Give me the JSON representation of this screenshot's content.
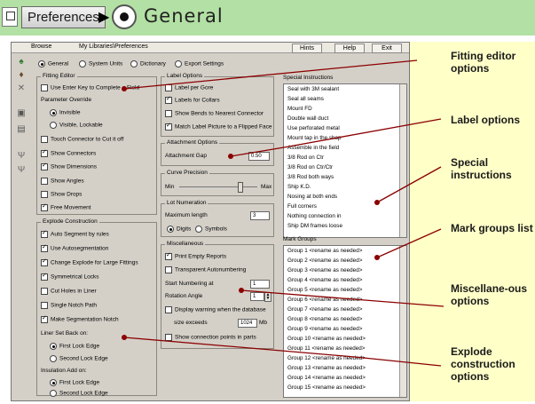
{
  "breadcrumb": {
    "prefs_label": "Preferences",
    "separator": "▶",
    "current": "General"
  },
  "menubar": {
    "browse": "Browse",
    "path": "My Libraries\\Preferences",
    "hints": "Hints",
    "help": "Help",
    "exit": "Exit"
  },
  "tabs": [
    "General",
    "System Units",
    "Dictionary",
    "Export Settings"
  ],
  "fitting_editor": {
    "title": "Fitting Editor",
    "use_enter": "Use Enter Key to Complete a Field",
    "param_override": "Parameter Override",
    "invisible": "Invisible",
    "visible_lockable": "Visible, Lockable",
    "touch_connector": "Touch Connector to Cut it off",
    "show_connectors": "Show Connectors",
    "show_dimensions": "Show Dimensions",
    "show_angles": "Show Angles",
    "show_drops": "Show Drops",
    "free_movement": "Free Movement"
  },
  "explode": {
    "title": "Explode Construction",
    "auto_segment": "Auto Segment by rules",
    "use_autoseg": "Use Autosegmentation",
    "change_explode": "Change Explode for Large Fittings",
    "symmetrical": "Symmetrical Locks",
    "cut_holes": "Cut Holes in Liner",
    "single_notch": "Single Notch Path",
    "make_seg": "Make Segmentation Notch",
    "liner_setback": "Liner Set Back on:",
    "first_lock": "First Lock Edge",
    "second_lock": "Second Lock Edge",
    "insulation": "Insulation Add on:",
    "first_lock2": "First Lock Edge",
    "second_lock2": "Second Lock Edge"
  },
  "label_options": {
    "title": "Label Options",
    "per_gore": "Label per Gore",
    "for_collars": "Labels for Collars",
    "show_bends": "Show Bends to Nearest Connector",
    "match_label": "Match Label Picture to a Flipped Face"
  },
  "attachment": {
    "title": "Attachment Options",
    "gap_label": "Attachment Gap",
    "gap_value": "0.50"
  },
  "curve": {
    "title": "Curve Precision",
    "min": "Min",
    "max": "Max",
    "level": 0.78
  },
  "lot": {
    "title": "Lot Numeration",
    "max_length_label": "Maximum length",
    "max_length_value": "3",
    "digits": "Digits",
    "symbols": "Symbols"
  },
  "misc": {
    "title": "Miscellaneous",
    "print_empty": "Print Empty Reports",
    "transparent": "Transparent Autonumbering",
    "start_num_label": "Start Numbering at",
    "start_num_value": "1",
    "rotation_label": "Rotation Angle",
    "rotation_value": "1",
    "display_warning": "Display warning when the database",
    "size_exceeds": "size exceeds",
    "size_value": "1024",
    "size_unit": "Mb",
    "show_conn_points": "Show connection points in parts"
  },
  "special_instructions": {
    "title": "Special Instructions",
    "items": [
      "Seal with 3M sealant",
      "Seal all seams",
      "Mount FD",
      "Double wall duct",
      "Use perforated metal",
      "Mount tap in the shop",
      "Assemble in the field",
      "3/8 Rod on Ctr",
      "3/8 Rod on Ctr/Ctr",
      "3/8 Rod both ways",
      "Ship K.D.",
      "Nosing at both ends",
      "Full corners",
      "Nothing connection in",
      "Ship DM frames loose"
    ]
  },
  "mark_groups": {
    "title": "Mark Groups",
    "items": [
      "Group 1 <rename as needed>",
      "Group 2 <rename as needed>",
      "Group 3 <rename as needed>",
      "Group 4 <rename as needed>",
      "Group 5 <rename as needed>",
      "Group 6 <rename as needed>",
      "Group 7 <rename as needed>",
      "Group 8 <rename as needed>",
      "Group 9 <rename as needed>",
      "Group 10 <rename as needed>",
      "Group 11 <rename as needed>",
      "Group 12 <rename as needed>",
      "Group 13 <rename as needed>",
      "Group 14 <rename as needed>",
      "Group 15 <rename as needed>"
    ]
  },
  "callouts": {
    "fitting": "Fitting editor options",
    "label": "Label options",
    "special": "Special instructions",
    "mark": "Mark groups list",
    "misc": "Miscellane-ous options",
    "explode": "Explode construction options"
  },
  "colors": {
    "breadcrumb_bg": "#b3e0a4",
    "callout_bg": "#ffffc8",
    "leader": "#8b0000",
    "window_bg": "#d4d0c8"
  }
}
